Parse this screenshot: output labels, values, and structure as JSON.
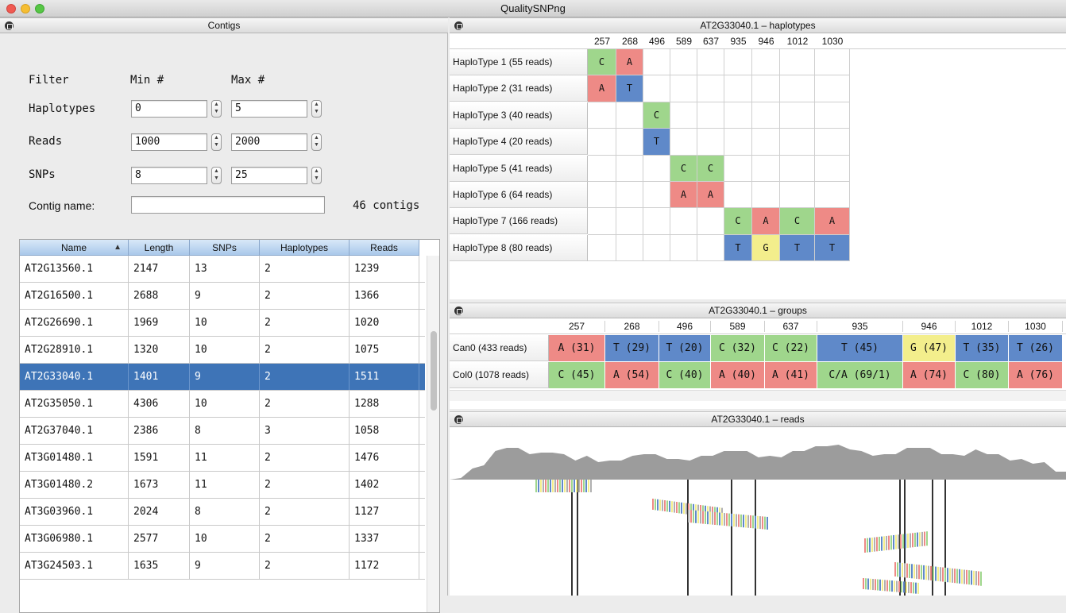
{
  "window": {
    "title": "QualitySNPng"
  },
  "contigs": {
    "panel_title": "Contigs",
    "filter": {
      "header_filter": "Filter",
      "header_min": "Min #",
      "header_max": "Max #",
      "haplotypes_label": "Haplotypes",
      "haplotypes_min": "0",
      "haplotypes_max": "5",
      "reads_label": "Reads",
      "reads_min": "1000",
      "reads_max": "2000",
      "snps_label": "SNPs",
      "snps_min": "8",
      "snps_max": "25",
      "contig_name_label": "Contig name:",
      "contig_name_value": "",
      "count": "46 contigs"
    },
    "table": {
      "columns": [
        "Name",
        "Length",
        "SNPs",
        "Haplotypes",
        "Reads"
      ],
      "sort_indicator": "▲",
      "rows": [
        [
          "AT2G13560.1",
          "2147",
          "13",
          "2",
          "1239"
        ],
        [
          "AT2G16500.1",
          "2688",
          "9",
          "2",
          "1366"
        ],
        [
          "AT2G26690.1",
          "1969",
          "10",
          "2",
          "1020"
        ],
        [
          "AT2G28910.1",
          "1320",
          "10",
          "2",
          "1075"
        ],
        [
          "AT2G33040.1",
          "1401",
          "9",
          "2",
          "1511"
        ],
        [
          "AT2G35050.1",
          "4306",
          "10",
          "2",
          "1288"
        ],
        [
          "AT2G37040.1",
          "2386",
          "8",
          "3",
          "1058"
        ],
        [
          "AT3G01480.1",
          "1591",
          "11",
          "2",
          "1476"
        ],
        [
          "AT3G01480.2",
          "1673",
          "11",
          "2",
          "1402"
        ],
        [
          "AT3G03960.1",
          "2024",
          "8",
          "2",
          "1127"
        ],
        [
          "AT3G06980.1",
          "2577",
          "10",
          "2",
          "1337"
        ],
        [
          "AT3G24503.1",
          "1635",
          "9",
          "2",
          "1172"
        ]
      ],
      "selected_row": 4
    }
  },
  "haplotypes": {
    "panel_title": "AT2G33040.1 – haplotypes",
    "positions": [
      "257",
      "268",
      "496",
      "589",
      "637",
      "935",
      "946",
      "1012",
      "1030"
    ],
    "rows": [
      {
        "label": "HaploType 1 (55 reads)",
        "bases": [
          "C",
          "A",
          "",
          "",
          "",
          "",
          "",
          "",
          ""
        ]
      },
      {
        "label": "HaploType 2 (31 reads)",
        "bases": [
          "A",
          "T",
          "",
          "",
          "",
          "",
          "",
          "",
          ""
        ]
      },
      {
        "label": "HaploType 3 (40 reads)",
        "bases": [
          "",
          "",
          "C",
          "",
          "",
          "",
          "",
          "",
          ""
        ]
      },
      {
        "label": "HaploType 4 (20 reads)",
        "bases": [
          "",
          "",
          "T",
          "",
          "",
          "",
          "",
          "",
          ""
        ]
      },
      {
        "label": "HaploType 5 (41 reads)",
        "bases": [
          "",
          "",
          "",
          "C",
          "C",
          "",
          "",
          "",
          ""
        ]
      },
      {
        "label": "HaploType 6 (64 reads)",
        "bases": [
          "",
          "",
          "",
          "A",
          "A",
          "",
          "",
          "",
          ""
        ]
      },
      {
        "label": "HaploType 7 (166 reads)",
        "bases": [
          "",
          "",
          "",
          "",
          "",
          "C",
          "A",
          "C",
          "A"
        ]
      },
      {
        "label": "HaploType 8 (80 reads)",
        "bases": [
          "",
          "",
          "",
          "",
          "",
          "T",
          "G",
          "T",
          "T"
        ]
      }
    ]
  },
  "groups": {
    "panel_title": "AT2G33040.1 – groups",
    "positions": [
      "257",
      "268",
      "496",
      "589",
      "637",
      "935",
      "946",
      "1012",
      "1030"
    ],
    "rows": [
      {
        "label": "Can0 (433 reads)",
        "cells": [
          {
            "text": "A (31)",
            "base": "A"
          },
          {
            "text": "T (29)",
            "base": "T"
          },
          {
            "text": "T (20)",
            "base": "T"
          },
          {
            "text": "C (32)",
            "base": "C"
          },
          {
            "text": "C (22)",
            "base": "C"
          },
          {
            "text": "T (45)",
            "base": "T"
          },
          {
            "text": "G (47)",
            "base": "G"
          },
          {
            "text": "T (35)",
            "base": "T"
          },
          {
            "text": "T (26)",
            "base": "T"
          }
        ]
      },
      {
        "label": "Col0 (1078 reads)",
        "cells": [
          {
            "text": "C (45)",
            "base": "C"
          },
          {
            "text": "A (54)",
            "base": "A"
          },
          {
            "text": "C (40)",
            "base": "C"
          },
          {
            "text": "A (40)",
            "base": "A"
          },
          {
            "text": "A (41)",
            "base": "A"
          },
          {
            "text": "C/A (69/1)",
            "base": "C"
          },
          {
            "text": "A (74)",
            "base": "A"
          },
          {
            "text": "C (80)",
            "base": "C"
          },
          {
            "text": "A (76)",
            "base": "A"
          }
        ]
      }
    ]
  },
  "reads": {
    "panel_title": "AT2G33040.1 – reads"
  },
  "colors": {
    "A": "#ee8a86",
    "C": "#9fd68c",
    "T": "#5f89c9",
    "G": "#f3ee8c",
    "selection": "#3e74b7"
  }
}
